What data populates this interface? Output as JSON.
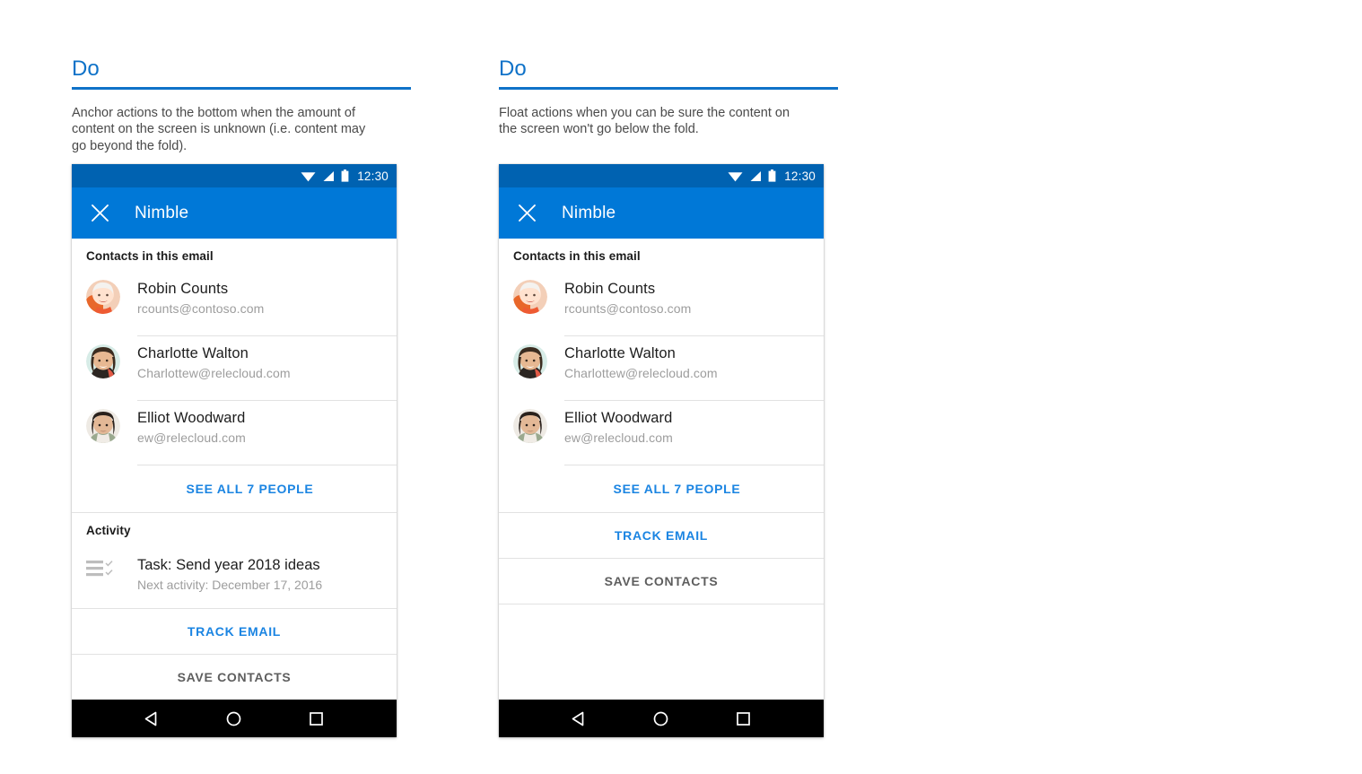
{
  "colors": {
    "accent_blue": "#0f72c8",
    "app_bar_blue": "#0078d7",
    "status_bar_blue": "#0062b1",
    "link_blue": "#1a84e2",
    "muted_text": "#9d9d9d",
    "save_gray": "#5e5e5e",
    "nav_black": "#000000"
  },
  "panels": [
    {
      "heading": "Do",
      "description": "Anchor actions to the bottom when the amount of content on the screen is unknown (i.e. content may go beyond the fold)."
    },
    {
      "heading": "Do",
      "description": "Float actions when you can be sure the content on the screen won't go below the fold."
    }
  ],
  "phone": {
    "status_bar": {
      "time": "12:30",
      "icons": [
        "wifi-icon",
        "cellular-signal-icon",
        "battery-icon"
      ]
    },
    "app_bar": {
      "close_label": "close-icon",
      "title": "Nimble"
    },
    "contacts_section": {
      "label": "Contacts in this email",
      "contacts": [
        {
          "name": "Robin Counts",
          "email": "rcounts@contoso.com",
          "avatar": "avatar-robin-counts"
        },
        {
          "name": "Charlotte Walton",
          "email": "Charlottew@relecloud.com",
          "avatar": "avatar-charlotte-walton"
        },
        {
          "name": "Elliot Woodward",
          "email": "ew@relecloud.com",
          "avatar": "avatar-elliot-woodward"
        }
      ],
      "see_all_label": "SEE ALL 7 PEOPLE"
    },
    "activity_section": {
      "label": "Activity",
      "items": [
        {
          "title": "Task: Send year 2018 ideas",
          "subtitle": "Next activity: December 17, 2016",
          "icon": "task-list-icon"
        }
      ]
    },
    "actions": {
      "track_email": "TRACK EMAIL",
      "save_contacts": "SAVE CONTACTS"
    },
    "nav_bar": {
      "back": "back-triangle-icon",
      "home": "home-circle-icon",
      "recents": "recents-square-icon"
    }
  }
}
